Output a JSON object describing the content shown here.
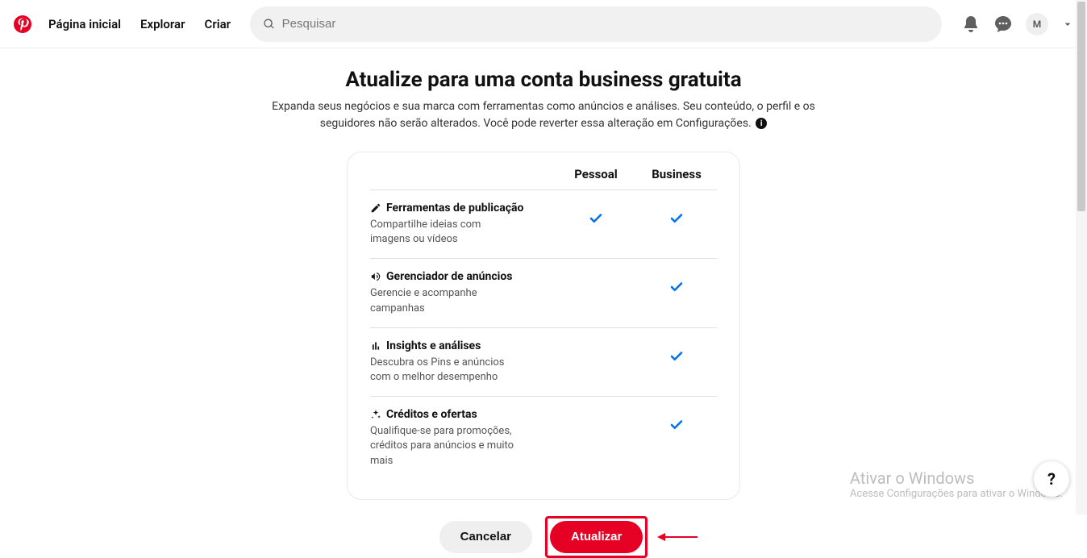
{
  "header": {
    "nav": {
      "home": "Página inicial",
      "explore": "Explorar",
      "create": "Criar"
    },
    "search_placeholder": "Pesquisar",
    "avatar_initial": "M"
  },
  "hero": {
    "title": "Atualize para uma conta business gratuita",
    "subtitle": "Expanda seus negócios e sua marca com ferramentas como anúncios e análises. Seu conteúdo, o perfil e os seguidores não serão alterados. Você pode reverter essa alteração em Configurações."
  },
  "table": {
    "col_personal": "Pessoal",
    "col_business": "Business",
    "rows": [
      {
        "title": "Ferramentas de publicação",
        "desc": "Compartilhe ideias com imagens ou vídeos",
        "personal": true,
        "business": true
      },
      {
        "title": "Gerenciador de anúncios",
        "desc": "Gerencie e acompanhe campanhas",
        "personal": false,
        "business": true
      },
      {
        "title": "Insights e análises",
        "desc": "Descubra os Pins e anúncios com o melhor desempenho",
        "personal": false,
        "business": true
      },
      {
        "title": "Créditos e ofertas",
        "desc": "Qualifique-se para promoções, créditos para anúncios e muito mais",
        "personal": false,
        "business": true
      }
    ]
  },
  "actions": {
    "cancel": "Cancelar",
    "upgrade": "Atualizar"
  },
  "watermark": {
    "line1": "Ativar o Windows",
    "line2": "Acesse Configurações para ativar o Windows."
  },
  "help_label": "?",
  "colors": {
    "accent": "#e60023",
    "check": "#0074e8"
  }
}
